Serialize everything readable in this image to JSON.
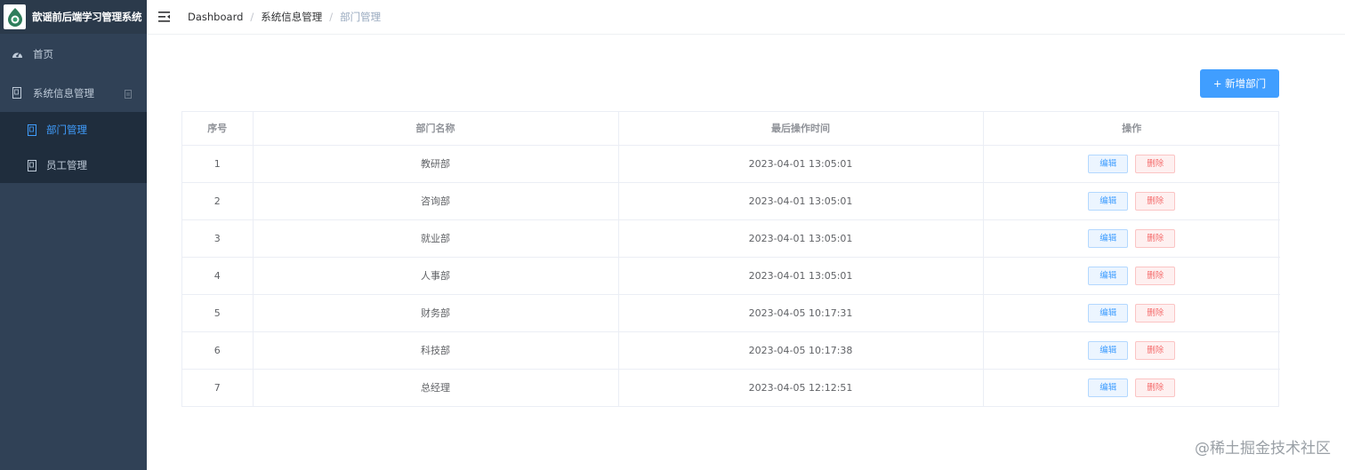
{
  "app": {
    "title": "歆谣前后端学习管理系统"
  },
  "sidebar": {
    "items": [
      {
        "label": "首页"
      },
      {
        "label": "系统信息管理",
        "children": [
          {
            "label": "部门管理",
            "active": true
          },
          {
            "label": "员工管理"
          }
        ]
      }
    ]
  },
  "breadcrumb": [
    "Dashboard",
    "系统信息管理",
    "部门管理"
  ],
  "toolbar": {
    "add_label": "+ 新增部门"
  },
  "table": {
    "headers": [
      "序号",
      "部门名称",
      "最后操作时间",
      "操作"
    ],
    "rows": [
      {
        "index": "1",
        "name": "教研部",
        "time": "2023-04-01 13:05:01"
      },
      {
        "index": "2",
        "name": "咨询部",
        "time": "2023-04-01 13:05:01"
      },
      {
        "index": "3",
        "name": "就业部",
        "time": "2023-04-01 13:05:01"
      },
      {
        "index": "4",
        "name": "人事部",
        "time": "2023-04-01 13:05:01"
      },
      {
        "index": "5",
        "name": "财务部",
        "time": "2023-04-05 10:17:31"
      },
      {
        "index": "6",
        "name": "科技部",
        "time": "2023-04-05 10:17:38"
      },
      {
        "index": "7",
        "name": "总经理",
        "time": "2023-04-05 12:12:51"
      }
    ],
    "edit_label": "编辑",
    "delete_label": "删除"
  },
  "watermark": "@稀土掘金技术社区",
  "colors": {
    "sidebar_bg": "#304156",
    "submenu_bg": "#1f2d3d",
    "primary": "#409eff",
    "danger": "#f56c6c"
  }
}
